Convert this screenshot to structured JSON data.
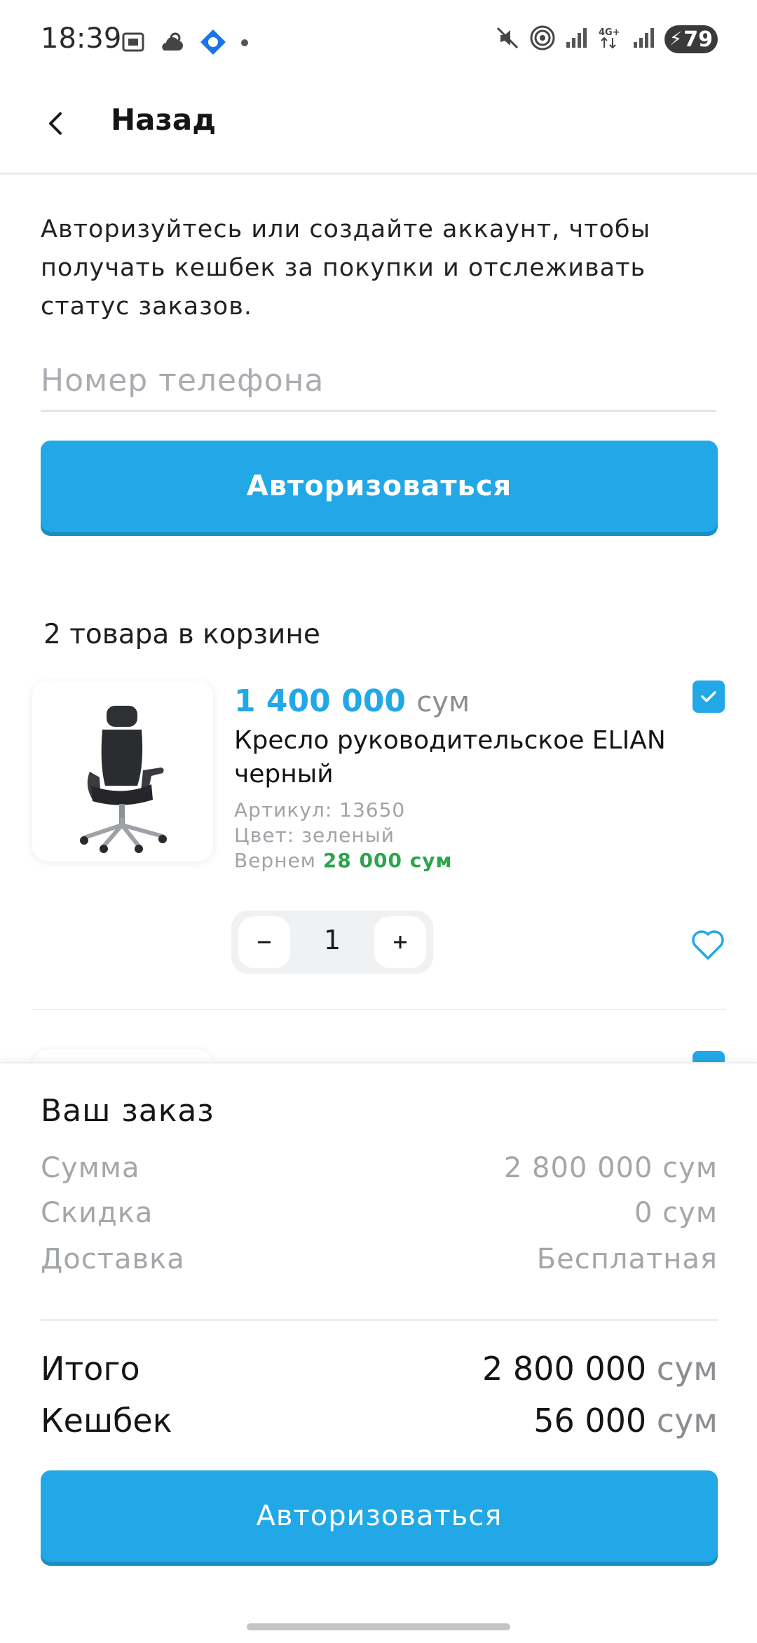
{
  "status_bar": {
    "time": "18:39",
    "battery": "79",
    "icons": [
      "screenshot-icon",
      "weather-icon",
      "app-notification-icon",
      "dot-icon",
      "mute-icon",
      "hotspot-icon",
      "signal-icon",
      "4g-icon",
      "signal-icon-2",
      "battery-icon"
    ]
  },
  "header": {
    "back_label": "Назад"
  },
  "auth": {
    "text": "Авторизуйтесь или создайте аккаунт, чтобы получать кешбек за покупки и отслеживать статус заказов.",
    "phone_placeholder": "Номер телефона",
    "button_label": "Авторизоваться"
  },
  "cart": {
    "title": "2 товара в корзине",
    "items": [
      {
        "price": "1 400 000",
        "currency": "сум",
        "name": "Кресло руководительское ELIAN черный",
        "article": "Артикул: 13650",
        "color": "Цвет: зеленый",
        "cashback_label": "Вернем",
        "cashback_value": "28 000 сум",
        "quantity": "1",
        "checked": true
      }
    ]
  },
  "summary": {
    "title": "Ваш заказ",
    "sum_label": "Сумма",
    "sum_value": "2 800 000 сум",
    "discount_label": "Скидка",
    "discount_value": "0 сум",
    "delivery_label": "Доставка",
    "delivery_value": "Бесплатная",
    "total_label": "Итого",
    "total_value": "2 800 000",
    "total_currency": "сум",
    "cashback_label": "Кешбек",
    "cashback_value": "56 000",
    "cashback_currency": "сум",
    "button_label": "Авторизоваться"
  },
  "colors": {
    "accent": "#22a8e6",
    "green": "#2da44e",
    "muted": "#a3a7ab"
  }
}
